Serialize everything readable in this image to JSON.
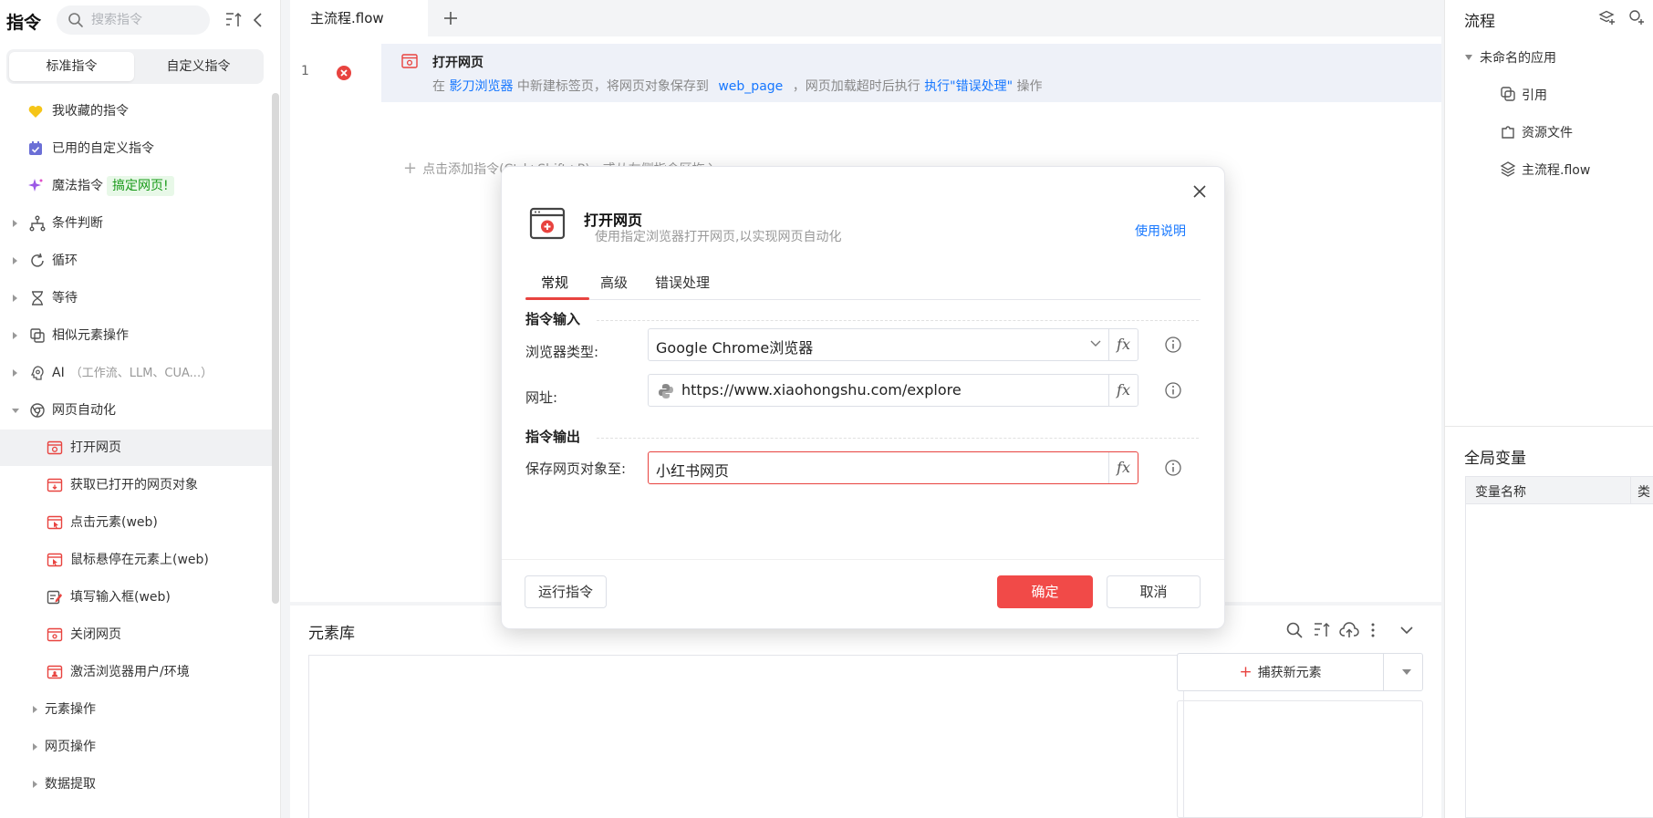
{
  "left_panel": {
    "title": "指令",
    "search_placeholder": "搜索指令",
    "tabs": [
      "标准指令",
      "自定义指令"
    ],
    "items": [
      {
        "label": "我收藏的指令",
        "icon": "heart-icon"
      },
      {
        "label": "已用的自定义指令",
        "icon": "calendar-check-icon"
      },
      {
        "label": "魔法指令",
        "icon": "sparkle-icon",
        "badge": "搞定网页!"
      },
      {
        "label": "条件判断",
        "icon": "branch-icon"
      },
      {
        "label": "循环",
        "icon": "loop-icon"
      },
      {
        "label": "等待",
        "icon": "hourglass-icon"
      },
      {
        "label": "相似元素操作",
        "icon": "copy-icon"
      },
      {
        "label": "AI",
        "icon": "ai-icon",
        "sub": "（工作流、LLM、CUA...）"
      },
      {
        "label": "网页自动化",
        "icon": "chrome-icon"
      },
      {
        "label": "打开网页",
        "icon": "browser-open-icon"
      },
      {
        "label": "获取已打开的网页对象",
        "icon": "browser-get-icon"
      },
      {
        "label": "点击元素(web)",
        "icon": "browser-click-icon"
      },
      {
        "label": "鼠标悬停在元素上(web)",
        "icon": "browser-hover-icon"
      },
      {
        "label": "填写输入框(web)",
        "icon": "form-edit-icon"
      },
      {
        "label": "关闭网页",
        "icon": "browser-close-icon"
      },
      {
        "label": "激活浏览器用户/环境",
        "icon": "browser-activate-icon"
      },
      {
        "label": "元素操作"
      },
      {
        "label": "网页操作"
      },
      {
        "label": "数据提取"
      }
    ]
  },
  "editor": {
    "file_tab": "主流程.flow",
    "row": {
      "line": "1",
      "title": "打开网页",
      "desc_1": "在",
      "desc_browser": "影刀浏览器",
      "desc_2": "中新建标签页，将网页对象保存到",
      "desc_var": "web_page",
      "desc_3": "，网页加载超时后执行",
      "desc_action": "执行\"错误处理\"",
      "desc_4": "操作"
    },
    "add_hint": "点击添加指令(Ctrl+Shift+P)，或从左侧指令区拖入"
  },
  "bottom": {
    "title": "元素库",
    "capture_label": "捕获新元素"
  },
  "right_panel": {
    "title": "流程",
    "app_name": "未命名的应用",
    "items": [
      "引用",
      "资源文件",
      "主流程.flow"
    ],
    "vars_title": "全局变量",
    "vars_col1": "变量名称",
    "vars_col2": "类"
  },
  "modal": {
    "title": "打开网页",
    "subtitle": "使用指定浏览器打开网页,以实现网页自动化",
    "help": "使用说明",
    "tabs": [
      "常规",
      "高级",
      "错误处理"
    ],
    "section_input": "指令输入",
    "browser_label": "浏览器类型:",
    "browser_value": "Google Chrome浏览器",
    "url_label": "网址:",
    "url_value": "https://www.xiaohongshu.com/explore",
    "section_output": "指令输出",
    "save_label": "保存网页对象至:",
    "save_value": "小红书网页",
    "fx_label": "fx",
    "btn_run": "运行指令",
    "btn_ok": "确定",
    "btn_cancel": "取消"
  },
  "colors": {
    "accent_red": "#f14a48",
    "link_blue": "#1677ff",
    "badge_green": "#1a9b1a"
  }
}
